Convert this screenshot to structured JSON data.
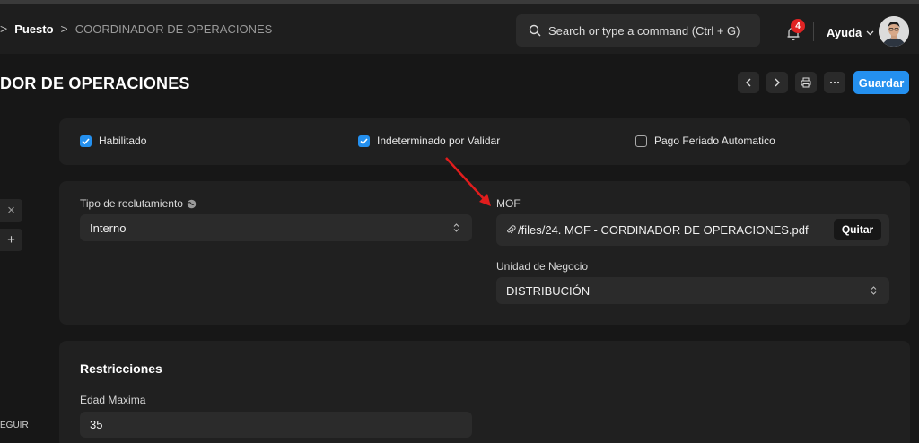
{
  "breadcrumb": {
    "sep": ">",
    "item1": "Puesto",
    "item2": "COORDINADOR DE OPERACIONES"
  },
  "search": {
    "placeholder": "Search or type a command (Ctrl + G)"
  },
  "notifications": {
    "count": "4"
  },
  "help": {
    "label": "Ayuda"
  },
  "page": {
    "title": "DOR DE OPERACIONES"
  },
  "toolbar": {
    "save_label": "Guardar"
  },
  "sidebar": {
    "bottom_text": "EGUIR"
  },
  "checks": [
    {
      "label": "Habilitado",
      "checked": true
    },
    {
      "label": "Indeterminado por Validar",
      "checked": true
    },
    {
      "label": "Pago Feriado Automatico",
      "checked": false
    }
  ],
  "form": {
    "tipo_label": "Tipo de reclutamiento",
    "tipo_value": "Interno",
    "mof_label": "MOF",
    "mof_value": "/files/24. MOF - CORDINADOR DE OPERACIONES.pdf",
    "mof_remove": "Quitar",
    "unidad_label": "Unidad de Negocio",
    "unidad_value": "DISTRIBUCIÓN"
  },
  "restricciones": {
    "title": "Restricciones",
    "edad_label": "Edad Maxima",
    "edad_value": "35"
  },
  "colors": {
    "accent": "#2490ef",
    "badge": "#e02424",
    "annotation_arrow": "#e11d1d"
  }
}
